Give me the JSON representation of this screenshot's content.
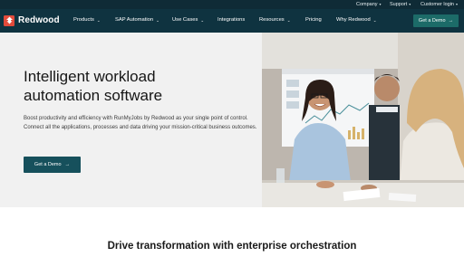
{
  "utility_nav": {
    "company": "Company",
    "support": "Support",
    "customer_login": "Customer login"
  },
  "brand": {
    "name": "Redwood",
    "accent_color": "#e24b3b",
    "nav_bg": "#0f3340",
    "cta_color": "#1c6b68"
  },
  "main_nav": {
    "items": [
      {
        "label": "Products",
        "has_dropdown": true
      },
      {
        "label": "SAP Automation",
        "has_dropdown": true
      },
      {
        "label": "Use Cases",
        "has_dropdown": true
      },
      {
        "label": "Integrations",
        "has_dropdown": false
      },
      {
        "label": "Resources",
        "has_dropdown": true
      },
      {
        "label": "Pricing",
        "has_dropdown": false
      },
      {
        "label": "Why Redwood",
        "has_dropdown": true
      }
    ],
    "cta_label": "Get a Demo",
    "cta_icon": "arrow-right-icon"
  },
  "hero": {
    "title_line1": "Intelligent workload",
    "title_line2": "automation software",
    "description": "Boost productivity and efficiency with RunMyJobs by Redwood as your single point of control. Connect all the applications, processes and data driving your mission-critical business outcomes.",
    "button_label": "Get a Demo",
    "button_icon": "arrow-right-icon",
    "image_alt": "office-team-meeting-photo"
  },
  "section": {
    "title": "Drive transformation with enterprise orchestration"
  }
}
